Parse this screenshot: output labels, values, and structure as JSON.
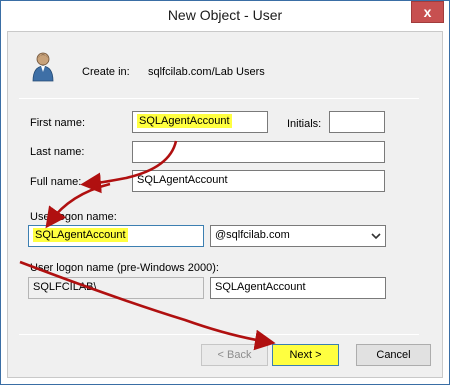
{
  "window": {
    "title": "New Object - User",
    "close_glyph": "x"
  },
  "header": {
    "create_in_label": "Create in:",
    "create_in_value": "sqlfcilab.com/Lab Users"
  },
  "fields": {
    "first_name_label": "First name:",
    "first_name_value": "SQLAgentAccount",
    "initials_label": "Initials:",
    "initials_value": "",
    "last_name_label": "Last name:",
    "last_name_value": "",
    "full_name_label": "Full name:",
    "full_name_value": "SQLAgentAccount",
    "logon_label": "User logon name:",
    "logon_value": "SQLAgentAccount",
    "domain_value": "@sqlfcilab.com",
    "pre2000_label": "User logon name (pre-Windows 2000):",
    "pre2000_domain_value": "SQLFCILAB\\",
    "pre2000_name_value": "SQLAgentAccount"
  },
  "buttons": {
    "back": "< Back",
    "next": "Next >",
    "cancel": "Cancel"
  },
  "colors": {
    "highlight": "#ffff40",
    "annotation_arrow": "#b01010"
  },
  "icons": {
    "user": "user-icon",
    "dropdown": "chevron-down-icon"
  }
}
